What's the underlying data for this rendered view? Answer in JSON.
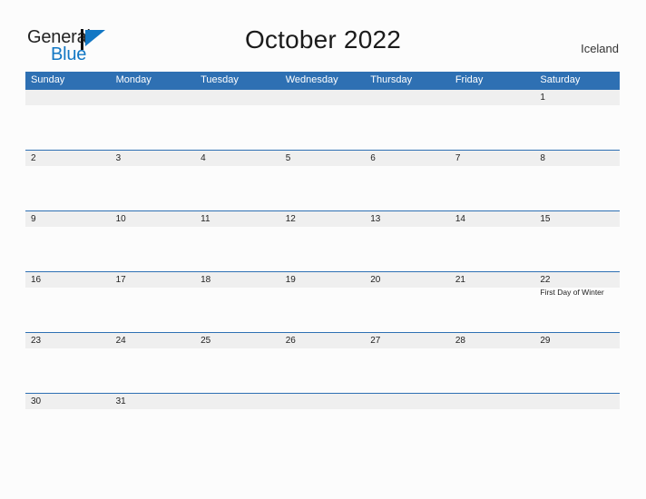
{
  "brand": {
    "name_part1": "General",
    "name_part2": "Blue",
    "flag_icon": "triangle-flag-icon"
  },
  "header": {
    "title": "October 2022",
    "country": "Iceland"
  },
  "calendar": {
    "weekdays": [
      "Sunday",
      "Monday",
      "Tuesday",
      "Wednesday",
      "Thursday",
      "Friday",
      "Saturday"
    ],
    "colors": {
      "header_blue": "#2e70b3",
      "band_gray": "#efefef",
      "page_background": "#fcfcfc",
      "brand_blue": "#1277c4",
      "text": "#222222"
    },
    "weeks": [
      {
        "days": [
          {
            "number": "",
            "events": []
          },
          {
            "number": "",
            "events": []
          },
          {
            "number": "",
            "events": []
          },
          {
            "number": "",
            "events": []
          },
          {
            "number": "",
            "events": []
          },
          {
            "number": "",
            "events": []
          },
          {
            "number": "1",
            "events": []
          }
        ]
      },
      {
        "days": [
          {
            "number": "2",
            "events": []
          },
          {
            "number": "3",
            "events": []
          },
          {
            "number": "4",
            "events": []
          },
          {
            "number": "5",
            "events": []
          },
          {
            "number": "6",
            "events": []
          },
          {
            "number": "7",
            "events": []
          },
          {
            "number": "8",
            "events": []
          }
        ]
      },
      {
        "days": [
          {
            "number": "9",
            "events": []
          },
          {
            "number": "10",
            "events": []
          },
          {
            "number": "11",
            "events": []
          },
          {
            "number": "12",
            "events": []
          },
          {
            "number": "13",
            "events": []
          },
          {
            "number": "14",
            "events": []
          },
          {
            "number": "15",
            "events": []
          }
        ]
      },
      {
        "days": [
          {
            "number": "16",
            "events": []
          },
          {
            "number": "17",
            "events": []
          },
          {
            "number": "18",
            "events": []
          },
          {
            "number": "19",
            "events": []
          },
          {
            "number": "20",
            "events": []
          },
          {
            "number": "21",
            "events": []
          },
          {
            "number": "22",
            "events": [
              "First Day of Winter"
            ]
          }
        ]
      },
      {
        "days": [
          {
            "number": "23",
            "events": []
          },
          {
            "number": "24",
            "events": []
          },
          {
            "number": "25",
            "events": []
          },
          {
            "number": "26",
            "events": []
          },
          {
            "number": "27",
            "events": []
          },
          {
            "number": "28",
            "events": []
          },
          {
            "number": "29",
            "events": []
          }
        ]
      },
      {
        "days": [
          {
            "number": "30",
            "events": []
          },
          {
            "number": "31",
            "events": []
          },
          {
            "number": "",
            "events": []
          },
          {
            "number": "",
            "events": []
          },
          {
            "number": "",
            "events": []
          },
          {
            "number": "",
            "events": []
          },
          {
            "number": "",
            "events": []
          }
        ]
      }
    ]
  }
}
